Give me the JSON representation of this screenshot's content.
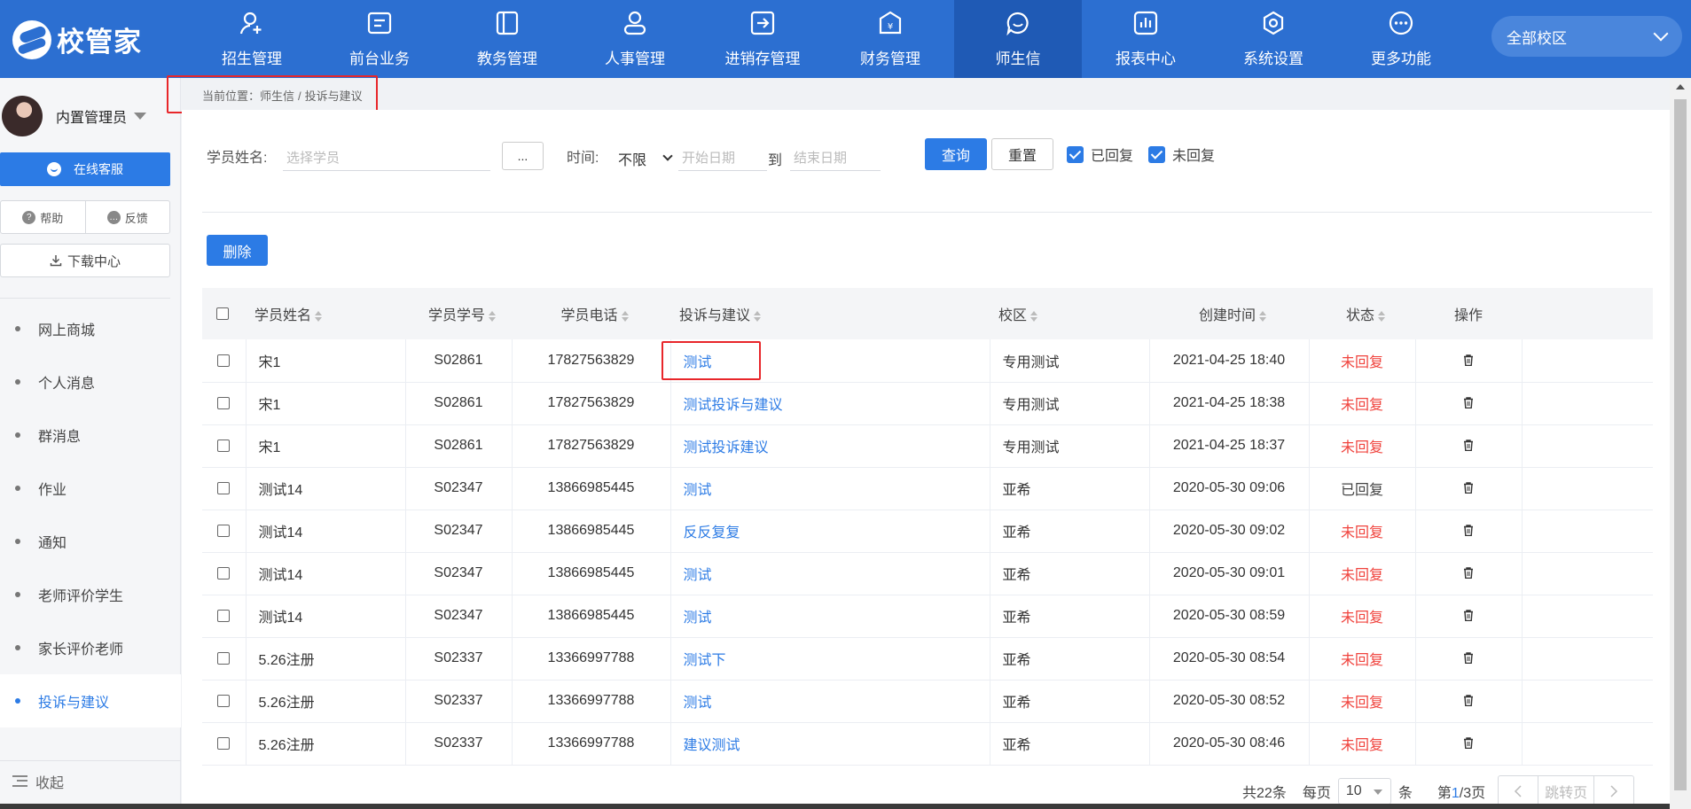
{
  "app": {
    "logo_text": "校管家",
    "campus": "全部校区"
  },
  "nav": [
    {
      "label": "招生管理",
      "icon": "person-add-icon"
    },
    {
      "label": "前台业务",
      "icon": "front-desk-icon"
    },
    {
      "label": "教务管理",
      "icon": "book-icon"
    },
    {
      "label": "人事管理",
      "icon": "person-icon"
    },
    {
      "label": "进销存管理",
      "icon": "inventory-icon"
    },
    {
      "label": "财务管理",
      "icon": "finance-icon"
    },
    {
      "label": "师生信",
      "icon": "chat-icon",
      "active": true
    },
    {
      "label": "报表中心",
      "icon": "report-icon"
    },
    {
      "label": "系统设置",
      "icon": "settings-icon"
    },
    {
      "label": "更多功能",
      "icon": "more-icon"
    }
  ],
  "sidebar": {
    "user_name": "内置管理员",
    "service_label": "在线客服",
    "help_label": "帮助",
    "feedback_label": "反馈",
    "download_label": "下载中心",
    "items": [
      {
        "label": "网上商城"
      },
      {
        "label": "个人消息"
      },
      {
        "label": "群消息"
      },
      {
        "label": "作业"
      },
      {
        "label": "通知"
      },
      {
        "label": "老师评价学生"
      },
      {
        "label": "家长评价老师"
      },
      {
        "label": "投诉与建议",
        "active": true
      }
    ],
    "collapse_label": "收起"
  },
  "breadcrumb": {
    "prefix": "当前位置：",
    "parent": "师生信",
    "separator": "/",
    "current": "投诉与建议"
  },
  "filter": {
    "student_label": "学员姓名:",
    "student_placeholder": "选择学员",
    "dots_label": "...",
    "time_label": "时间:",
    "time_value": "不限",
    "start_placeholder": "开始日期",
    "to_label": "到",
    "end_placeholder": "结束日期",
    "query_label": "查询",
    "reset_label": "重置",
    "replied_label": "已回复",
    "unreplied_label": "未回复"
  },
  "actions": {
    "delete_label": "删除"
  },
  "table": {
    "headers": [
      "学员姓名",
      "学员学号",
      "学员电话",
      "投诉与建议",
      "校区",
      "创建时间",
      "状态",
      "操作"
    ],
    "rows": [
      {
        "name": "宋1",
        "id": "S02861",
        "phone": "17827563829",
        "content": "测试",
        "campus": "专用测试",
        "time": "2021-04-25 18:40",
        "status": "未回复",
        "replied": false
      },
      {
        "name": "宋1",
        "id": "S02861",
        "phone": "17827563829",
        "content": "测试投诉与建议",
        "campus": "专用测试",
        "time": "2021-04-25 18:38",
        "status": "未回复",
        "replied": false
      },
      {
        "name": "宋1",
        "id": "S02861",
        "phone": "17827563829",
        "content": "测试投诉建议",
        "campus": "专用测试",
        "time": "2021-04-25 18:37",
        "status": "未回复",
        "replied": false
      },
      {
        "name": "测试14",
        "id": "S02347",
        "phone": "13866985445",
        "content": "测试",
        "campus": "亚希",
        "time": "2020-05-30 09:06",
        "status": "已回复",
        "replied": true
      },
      {
        "name": "测试14",
        "id": "S02347",
        "phone": "13866985445",
        "content": "反反复复",
        "campus": "亚希",
        "time": "2020-05-30 09:02",
        "status": "未回复",
        "replied": false
      },
      {
        "name": "测试14",
        "id": "S02347",
        "phone": "13866985445",
        "content": "测试",
        "campus": "亚希",
        "time": "2020-05-30 09:01",
        "status": "未回复",
        "replied": false
      },
      {
        "name": "测试14",
        "id": "S02347",
        "phone": "13866985445",
        "content": "测试",
        "campus": "亚希",
        "time": "2020-05-30 08:59",
        "status": "未回复",
        "replied": false
      },
      {
        "name": "5.26注册",
        "id": "S02337",
        "phone": "13366997788",
        "content": "测试下",
        "campus": "亚希",
        "time": "2020-05-30 08:54",
        "status": "未回复",
        "replied": false
      },
      {
        "name": "5.26注册",
        "id": "S02337",
        "phone": "13366997788",
        "content": "测试",
        "campus": "亚希",
        "time": "2020-05-30 08:52",
        "status": "未回复",
        "replied": false
      },
      {
        "name": "5.26注册",
        "id": "S02337",
        "phone": "13366997788",
        "content": "建议测试",
        "campus": "亚希",
        "time": "2020-05-30 08:46",
        "status": "未回复",
        "replied": false
      }
    ]
  },
  "pagination": {
    "total": "共22条",
    "per_page_label": "每页",
    "per_page": "10",
    "unit": "条",
    "page_prefix": "第",
    "current_page": "1",
    "page_suffix": "/3页",
    "jump_label": "跳转页"
  },
  "colors": {
    "brand": "#2c6fd1",
    "accent": "#2c7be5",
    "unreplied": "#f0433d",
    "highlight": "#e8262a"
  }
}
